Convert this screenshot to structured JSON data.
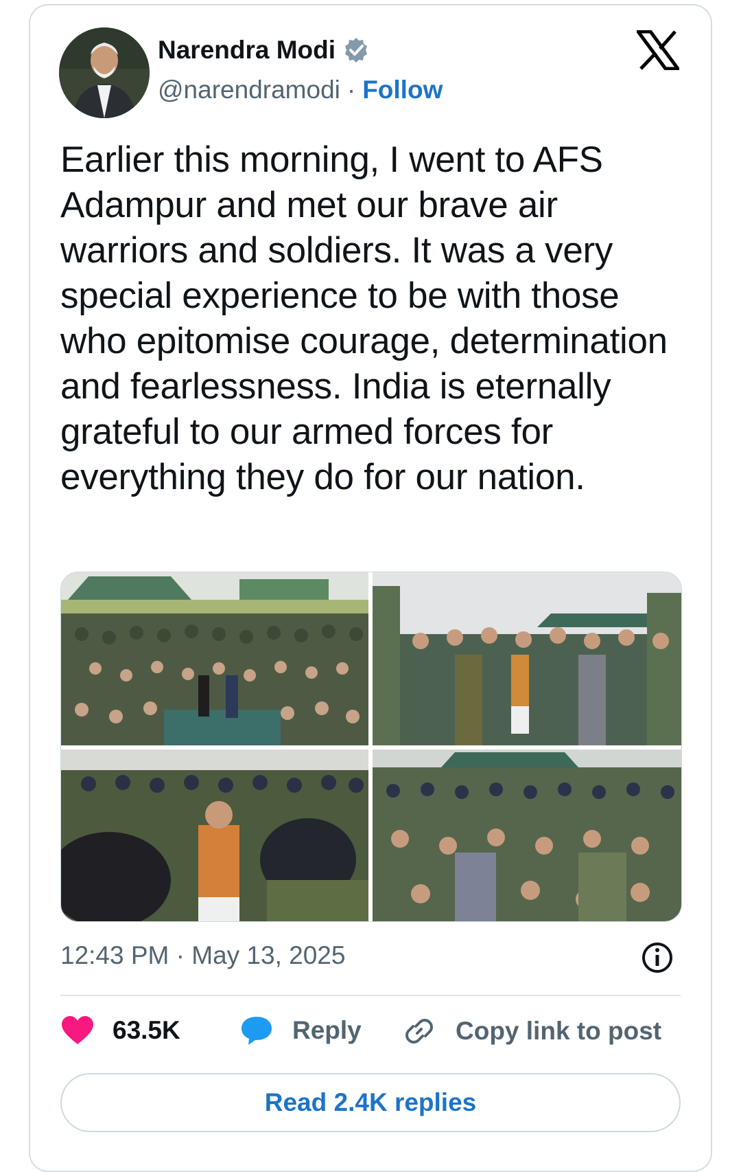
{
  "author": {
    "name": "Narendra Modi",
    "handle": "@narendramodi",
    "separator": "·",
    "follow_label": "Follow",
    "verified": true
  },
  "tweet": {
    "text": "Earlier this morning, I went to AFS Adampur and met our brave air warriors and soldiers. It was a very special experience to be with those who epitomise courage, determination and fearlessness. India is eternally grateful to our armed forces for everything they do for our nation.",
    "timestamp": "12:43 PM · May 13, 2025"
  },
  "actions": {
    "likes": "63.5K",
    "reply_label": "Reply",
    "copy_label": "Copy link to post"
  },
  "read_replies_label": "Read 2.4K replies",
  "colors": {
    "accent": "#1d73c9",
    "like": "#f91880",
    "reply_icon": "#1d9bf0",
    "muted": "#536471",
    "verified": "#829aab"
  },
  "icons": {
    "verified": "verified-badge-icon",
    "logo": "x-logo-icon",
    "info": "info-icon",
    "like": "heart-icon",
    "reply": "speech-bubble-icon",
    "copy": "link-icon"
  }
}
